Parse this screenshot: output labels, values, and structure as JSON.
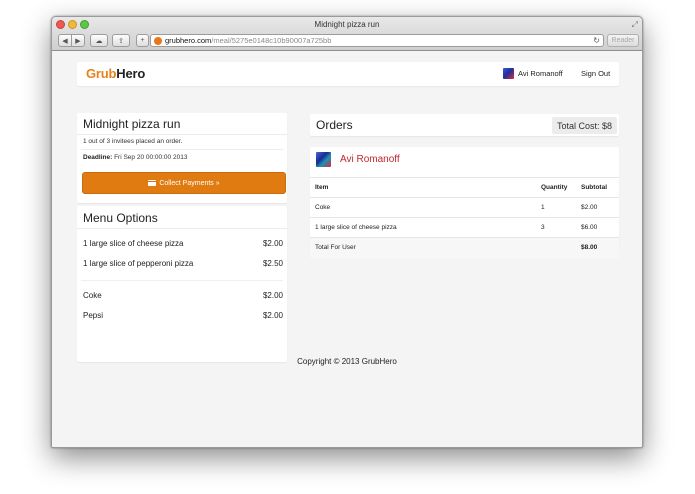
{
  "window": {
    "title": "Midnight pizza run",
    "url_host": "grubhero.com",
    "url_path": "/meal/5275e0148c10b90007a725bb",
    "reader_label": "Reader"
  },
  "navbar": {
    "brand_part1": "Grub",
    "brand_part2": "Hero",
    "user_name": "Avi Romanoff",
    "signout_label": "Sign Out"
  },
  "event": {
    "title": "Midnight pizza run",
    "invitees_text": "1 out of 3 invitees placed an order.",
    "deadline_label": "Deadline:",
    "deadline_value": " Fri Sep 20 00:00:00 2013",
    "collect_button_label": "Collect Payments »"
  },
  "menu": {
    "title": "Menu Options",
    "items": [
      {
        "name": "1 large slice of cheese pizza",
        "price": "$2.00"
      },
      {
        "name": "1 large slice of pepperoni pizza",
        "price": "$2.50"
      },
      {
        "name": "Coke",
        "price": "$2.00"
      },
      {
        "name": "Pepsi",
        "price": "$2.00"
      }
    ]
  },
  "orders": {
    "title": "Orders",
    "total_cost": "Total Cost: $8",
    "user": "Avi Romanoff",
    "columns": [
      "Item",
      "Quantity",
      "Subtotal"
    ],
    "rows": [
      {
        "item": "Coke",
        "quantity": "1",
        "subtotal": "$2.00"
      },
      {
        "item": "1 large slice of cheese pizza",
        "quantity": "3",
        "subtotal": "$6.00"
      }
    ],
    "total_label": "Total For User",
    "total_value": "$8.00"
  },
  "footer": {
    "copyright": "Copyright © 2013 GrubHero"
  },
  "colors": {
    "brand_orange": "#e8811b",
    "button_orange": "#e07b12",
    "order_user_red": "#c0262a"
  }
}
